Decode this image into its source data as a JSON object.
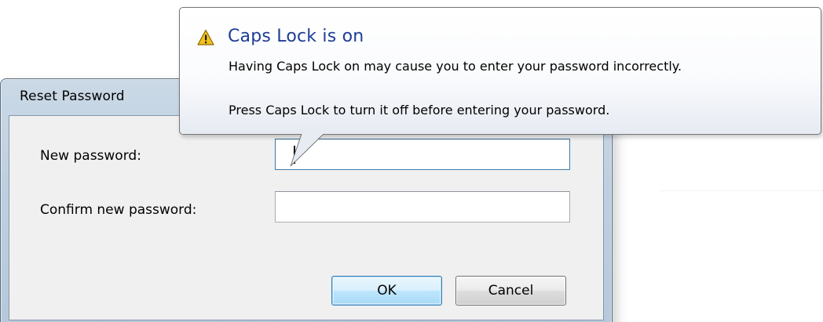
{
  "dialog": {
    "title": "Reset Password",
    "new_password_label": "New password:",
    "new_password_value": "",
    "confirm_password_label": "Confirm new password:",
    "confirm_password_value": "",
    "ok_label": "OK",
    "cancel_label": "Cancel"
  },
  "tooltip": {
    "icon": "warning-icon",
    "title": "Caps Lock is on",
    "line1": "Having Caps Lock on may cause you to enter your password incorrectly.",
    "line2": "Press Caps Lock to turn it off before entering your password.",
    "title_color": "#1e3d96",
    "icon_color": "#f2c21b"
  }
}
